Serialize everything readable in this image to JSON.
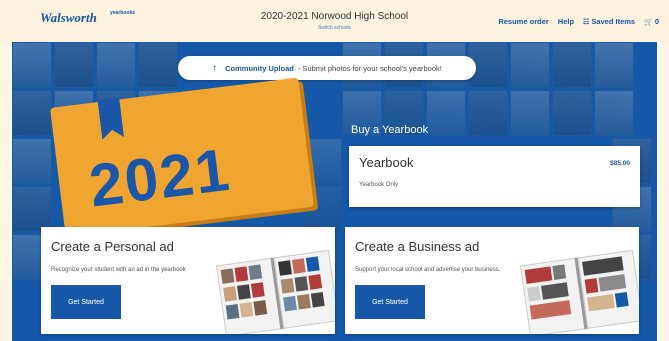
{
  "header": {
    "logo": "Walsworth",
    "logo_sub": "yearbooks",
    "school_title": "2020-2021 Norwood High School",
    "switch_school": "Switch schools",
    "nav": {
      "resume": "Resume order",
      "help": "Help",
      "saved_icon": "☷",
      "saved": "Saved Items",
      "cart_icon": "🛒",
      "cart_count": "0"
    }
  },
  "upload": {
    "icon": "↑",
    "title": "Community Upload",
    "text": "- Submit photos for your school's yearbook!"
  },
  "book": {
    "year": "2021"
  },
  "buy": {
    "heading": "Buy a Yearbook",
    "card": {
      "title": "Yearbook",
      "price": "$85.00",
      "subtitle": "Yearbook Only"
    }
  },
  "personal_ad": {
    "title": "Create a Personal ad",
    "desc": "Recognize your student with an ad in the yearbook",
    "button": "Get Started"
  },
  "business_ad": {
    "title": "Create a Business ad",
    "desc": "Support your local school and advertise your business.",
    "button": "Get Started"
  },
  "colors": {
    "brand": "#1659a8",
    "book": "#f0a530",
    "background": "#fdf6e3"
  }
}
